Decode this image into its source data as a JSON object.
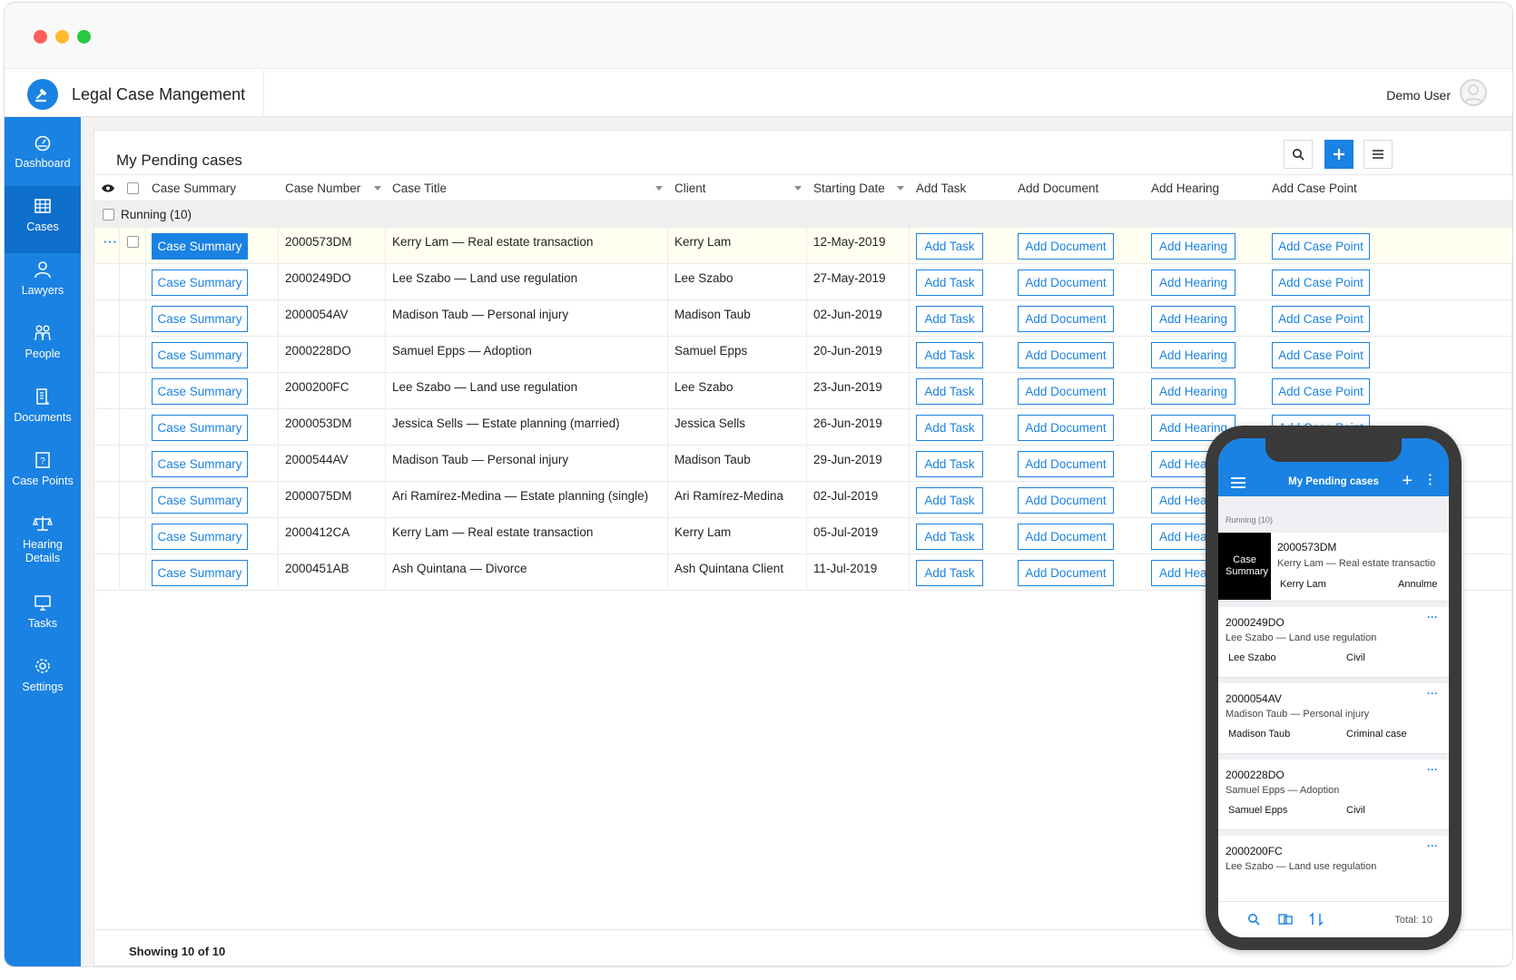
{
  "app": {
    "title": "Legal Case Mangement",
    "user_name": "Demo User"
  },
  "sidebar": {
    "items": [
      {
        "label": "Dashboard",
        "icon": "dashboard-icon"
      },
      {
        "label": "Cases",
        "icon": "cases-icon",
        "active": true
      },
      {
        "label": "Lawyers",
        "icon": "lawyer-icon"
      },
      {
        "label": "People",
        "icon": "people-icon"
      },
      {
        "label": "Documents",
        "icon": "documents-icon"
      },
      {
        "label": "Case Points",
        "icon": "case-points-icon"
      },
      {
        "label": "Hearing Details",
        "icon": "scales-icon"
      },
      {
        "label": "Tasks",
        "icon": "monitor-icon"
      },
      {
        "label": "Settings",
        "icon": "gear-icon"
      }
    ]
  },
  "panel": {
    "title": "My Pending cases",
    "columns": [
      "Case Summary",
      "Case Number",
      "Case Title",
      "Client",
      "Starting Date",
      "Add Task",
      "Add Document",
      "Add Hearing",
      "Add Case Point"
    ],
    "group_label": "Running (10)",
    "buttons": {
      "case_summary": "Case Summary",
      "add_task": "Add Task",
      "add_document": "Add Document",
      "add_hearing": "Add Hearing",
      "add_case_point": "Add Case Point"
    },
    "rows": [
      {
        "number": "2000573DM",
        "title": "Kerry Lam — Real estate transaction",
        "client": "Kerry Lam",
        "date": "12-May-2019"
      },
      {
        "number": "2000249DO",
        "title": "Lee Szabo — Land use regulation",
        "client": "Lee Szabo",
        "date": "27-May-2019"
      },
      {
        "number": "2000054AV",
        "title": "Madison Taub — Personal injury",
        "client": "Madison Taub",
        "date": "02-Jun-2019"
      },
      {
        "number": "2000228DO",
        "title": "Samuel Epps — Adoption",
        "client": "Samuel Epps",
        "date": "20-Jun-2019"
      },
      {
        "number": "2000200FC",
        "title": "Lee Szabo — Land use regulation",
        "client": "Lee Szabo",
        "date": "23-Jun-2019"
      },
      {
        "number": "2000053DM",
        "title": "Jessica Sells — Estate planning (married)",
        "client": "Jessica Sells",
        "date": "26-Jun-2019"
      },
      {
        "number": "2000544AV",
        "title": "Madison Taub — Personal injury",
        "client": "Madison Taub",
        "date": "29-Jun-2019"
      },
      {
        "number": "2000075DM",
        "title": "Ari Ramírez-Medina — Estate planning (single)",
        "client": "Ari Ramírez-Medina",
        "date": "02-Jul-2019"
      },
      {
        "number": "2000412CA",
        "title": "Kerry Lam — Real estate transaction",
        "client": "Kerry Lam",
        "date": "05-Jul-2019"
      },
      {
        "number": "2000451AB",
        "title": "Ash Quintana — Divorce",
        "client": "Ash Quintana Client",
        "date": "11-Jul-2019"
      }
    ],
    "footer": "Showing 10 of 10"
  },
  "phone": {
    "title": "My Pending cases",
    "group_label": "Running (10)",
    "first_card": {
      "summary_label": "Case Summary",
      "number": "2000573DM",
      "title": "Kerry Lam — Real estate transactio",
      "client": "Kerry Lam",
      "type": "Annulme"
    },
    "cards": [
      {
        "number": "2000249DO",
        "title": "Lee Szabo — Land use regulation",
        "client": "Lee Szabo",
        "type": "Civil"
      },
      {
        "number": "2000054AV",
        "title": "Madison Taub — Personal injury",
        "client": "Madison Taub",
        "type": "Criminal case"
      },
      {
        "number": "2000228DO",
        "title": "Samuel Epps — Adoption",
        "client": "Samuel Epps",
        "type": "Civil"
      },
      {
        "number": "2000200FC",
        "title": "Lee Szabo — Land use regulation",
        "client": "",
        "type": ""
      }
    ],
    "total": "Total: 10"
  },
  "colors": {
    "primary": "#1a82e2",
    "sidebar_active": "#0f6fcc",
    "row_highlight": "#fffef0"
  }
}
